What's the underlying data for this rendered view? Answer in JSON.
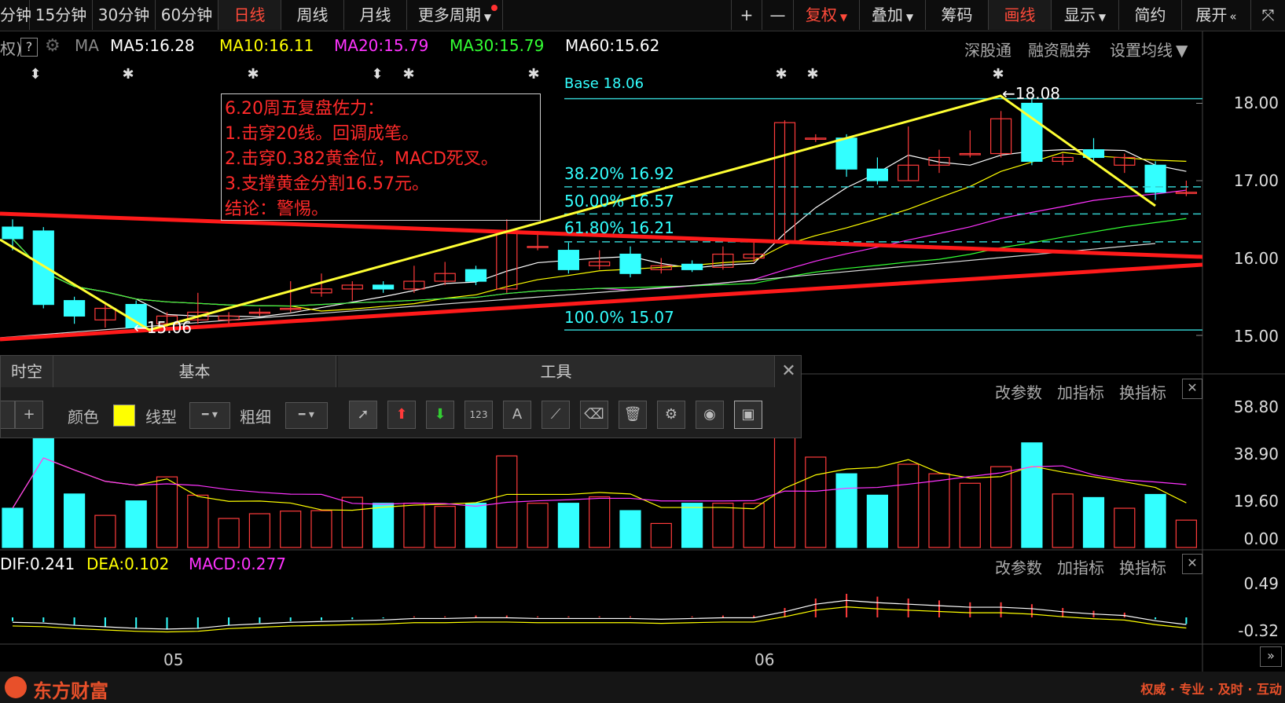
{
  "toolbar": {
    "periods": [
      "分钟",
      "15分钟",
      "30分钟",
      "60分钟",
      "日线",
      "周线",
      "月线",
      "更多周期"
    ],
    "active_period": "日线",
    "right_tools": [
      "+",
      "—",
      "复权",
      "叠加",
      "筹码",
      "画线",
      "显示",
      "简约",
      "展开"
    ]
  },
  "indicator_bar": {
    "prefix": "权)",
    "help": "?",
    "ma_label": "MA",
    "ma5": "MA5:16.28",
    "ma10": "MA10:16.11",
    "ma20": "MA20:15.79",
    "ma30": "MA30:15.79",
    "ma60": "MA60:15.62",
    "colors": {
      "ma5": "#ffffff",
      "ma10": "#ffff00",
      "ma20": "#ff33ff",
      "ma30": "#33ff33",
      "ma60": "#ffffff"
    }
  },
  "right_links": [
    "深股通",
    "融资融券",
    "设置均线"
  ],
  "price_axis": [
    "18.00",
    "17.00",
    "16.00",
    "15.00"
  ],
  "annotation": {
    "lines": [
      "6.20周五复盘佐力：",
      "1.击穿20线。回调成笔。",
      "2.击穿0.382黄金位，MACD死叉。",
      "3.支撑黄金分割16.57元。",
      "结论：警惕。"
    ]
  },
  "fib_labels": {
    "base": "Base 18.06",
    "f382": "38.20% 16.92",
    "f50": "50.00% 16.57",
    "f618": "61.80% 16.21",
    "f100": "100.0% 15.07"
  },
  "price_marks": {
    "high": "18.08",
    "low": "15.06"
  },
  "tool_panel": {
    "tabs": [
      "时空",
      "基本",
      "工具"
    ],
    "color_label": "颜色",
    "line_type_label": "线型",
    "thickness_label": "粗细",
    "tools": [
      "pointer-icon",
      "up-arrow-icon",
      "down-arrow-icon",
      "number-icon",
      "text-icon",
      "ruler-icon",
      "eraser-icon",
      "trash-icon",
      "gear-icon",
      "eye-icon",
      "snapshot-icon"
    ]
  },
  "volume_panel": {
    "actions": [
      "改参数",
      "加指标",
      "换指标"
    ],
    "axis": [
      "58.80",
      "38.90",
      "19.60",
      "0.00"
    ]
  },
  "macd_panel": {
    "dif": "DIF:0.241",
    "dea": "DEA:0.102",
    "macd": "MACD:0.277",
    "actions": [
      "改参数",
      "加指标",
      "换指标"
    ],
    "axis": [
      "0.49",
      "-0.32"
    ]
  },
  "date_axis": [
    "05",
    "06"
  ],
  "footer": {
    "brand": "东方财富",
    "slogan": "权威 · 专业 · 及时 · 互动"
  },
  "chart_data": {
    "type": "candlestick",
    "ylim": [
      14.75,
      18.35
    ],
    "candles": [
      {
        "o": 16.4,
        "c": 16.25,
        "h": 16.5,
        "l": 16.1
      },
      {
        "o": 16.35,
        "c": 15.4,
        "h": 16.4,
        "l": 15.35
      },
      {
        "o": 15.45,
        "c": 15.25,
        "h": 15.5,
        "l": 15.15
      },
      {
        "o": 15.2,
        "c": 15.35,
        "h": 15.4,
        "l": 15.1
      },
      {
        "o": 15.4,
        "c": 15.1,
        "h": 15.45,
        "l": 15.06
      },
      {
        "o": 15.15,
        "c": 15.25,
        "h": 15.3,
        "l": 15.08
      },
      {
        "o": 15.2,
        "c": 15.3,
        "h": 15.55,
        "l": 15.15
      },
      {
        "o": 15.2,
        "c": 15.25,
        "h": 15.3,
        "l": 15.15
      },
      {
        "o": 15.3,
        "c": 15.3,
        "h": 15.35,
        "l": 15.25
      },
      {
        "o": 15.35,
        "c": 15.35,
        "h": 15.7,
        "l": 15.3
      },
      {
        "o": 15.55,
        "c": 15.6,
        "h": 15.8,
        "l": 15.5
      },
      {
        "o": 15.6,
        "c": 15.65,
        "h": 15.7,
        "l": 15.45
      },
      {
        "o": 15.65,
        "c": 15.6,
        "h": 15.7,
        "l": 15.55
      },
      {
        "o": 15.6,
        "c": 15.7,
        "h": 15.9,
        "l": 15.55
      },
      {
        "o": 15.7,
        "c": 15.8,
        "h": 15.95,
        "l": 15.65
      },
      {
        "o": 15.85,
        "c": 15.7,
        "h": 15.9,
        "l": 15.65
      },
      {
        "o": 15.6,
        "c": 16.35,
        "h": 16.5,
        "l": 15.55
      },
      {
        "o": 16.15,
        "c": 16.15,
        "h": 16.35,
        "l": 16.1
      },
      {
        "o": 16.1,
        "c": 15.85,
        "h": 16.2,
        "l": 15.8
      },
      {
        "o": 15.9,
        "c": 15.95,
        "h": 16.1,
        "l": 15.85
      },
      {
        "o": 16.05,
        "c": 15.8,
        "h": 16.15,
        "l": 15.75
      },
      {
        "o": 15.85,
        "c": 15.9,
        "h": 16.0,
        "l": 15.8
      },
      {
        "o": 15.92,
        "c": 15.85,
        "h": 15.97,
        "l": 15.82
      },
      {
        "o": 15.88,
        "c": 16.05,
        "h": 16.15,
        "l": 15.85
      },
      {
        "o": 16.0,
        "c": 16.05,
        "h": 16.2,
        "l": 15.95
      },
      {
        "o": 16.2,
        "c": 17.75,
        "h": 17.78,
        "l": 16.2
      },
      {
        "o": 17.55,
        "c": 17.55,
        "h": 17.6,
        "l": 17.5
      },
      {
        "o": 17.55,
        "c": 17.15,
        "h": 17.6,
        "l": 17.05
      },
      {
        "o": 17.15,
        "c": 17.0,
        "h": 17.3,
        "l": 16.95
      },
      {
        "o": 17.0,
        "c": 17.2,
        "h": 17.7,
        "l": 17.0
      },
      {
        "o": 17.2,
        "c": 17.3,
        "h": 17.4,
        "l": 17.1
      },
      {
        "o": 17.35,
        "c": 17.35,
        "h": 17.65,
        "l": 17.3
      },
      {
        "o": 17.35,
        "c": 17.8,
        "h": 17.9,
        "l": 17.3
      },
      {
        "o": 18.0,
        "c": 17.25,
        "h": 18.08,
        "l": 17.2
      },
      {
        "o": 17.25,
        "c": 17.3,
        "h": 17.35,
        "l": 17.2
      },
      {
        "o": 17.4,
        "c": 17.3,
        "h": 17.55,
        "l": 17.25
      },
      {
        "o": 17.2,
        "c": 17.3,
        "h": 17.35,
        "l": 17.1
      },
      {
        "o": 17.2,
        "c": 16.85,
        "h": 17.25,
        "l": 16.75
      },
      {
        "o": 16.85,
        "c": 16.85,
        "h": 17.0,
        "l": 16.8
      }
    ],
    "volume": [
      16.5,
      58.8,
      22.5,
      13.5,
      19.6,
      29.7,
      22.0,
      12.2,
      14.2,
      15.3,
      15.5,
      21.1,
      18.6,
      18.6,
      17.3,
      18.6,
      38.5,
      18.6,
      18.6,
      21.3,
      15.5,
      10.1,
      18.6,
      18.6,
      18.6,
      58.8,
      38.0,
      31.0,
      22.0,
      35.0,
      31.0,
      27.0,
      34.0,
      44.0,
      22.5,
      21.0,
      16.5,
      22.3,
      11.5
    ],
    "macd_bars": [
      -0.04,
      -0.05,
      -0.08,
      -0.1,
      -0.12,
      -0.13,
      -0.12,
      -0.08,
      -0.06,
      -0.04,
      -0.03,
      -0.02,
      -0.01,
      0.01,
      0.01,
      0.02,
      0.02,
      0.01,
      0.01,
      0.01,
      0.01,
      0.0,
      0.01,
      0.02,
      0.02,
      0.1,
      0.2,
      0.25,
      0.22,
      0.2,
      0.18,
      0.16,
      0.16,
      0.14,
      0.1,
      0.07,
      0.05,
      -0.02,
      -0.07
    ]
  }
}
